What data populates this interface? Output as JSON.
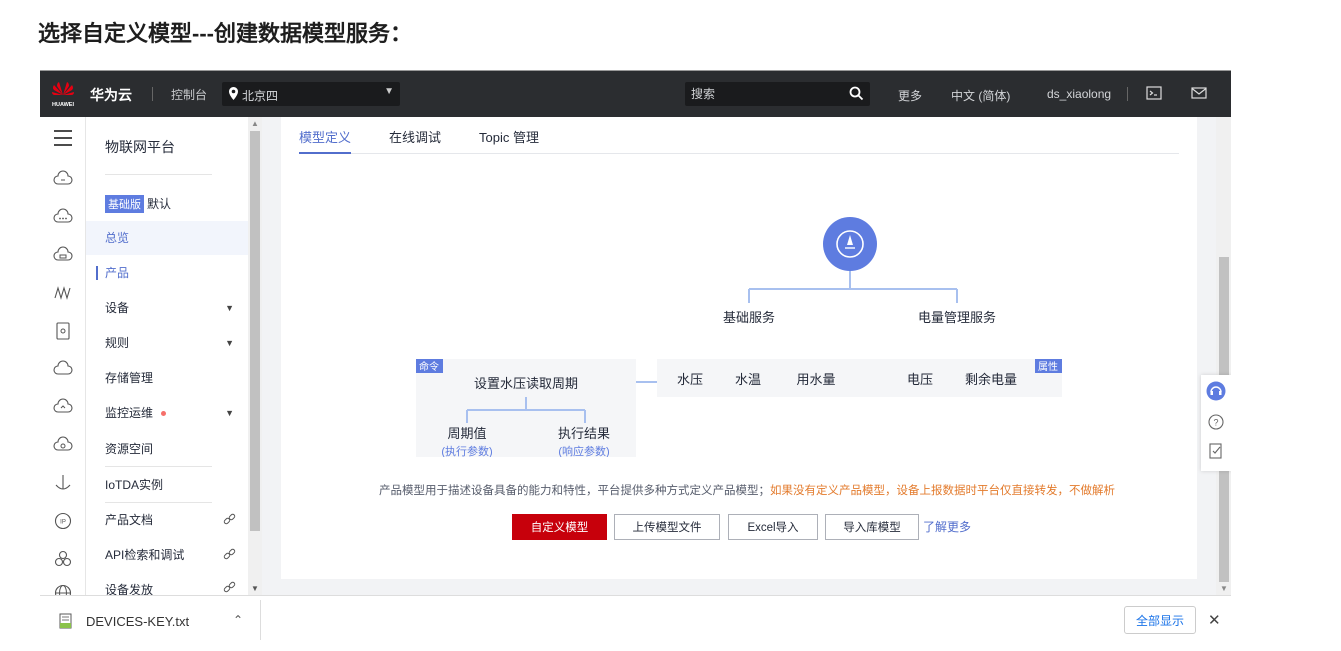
{
  "doc": {
    "heading": "选择自定义模型---创建数据模型服务："
  },
  "topbar": {
    "logo_text": "HUAWEI",
    "brand": "华为云",
    "console": "控制台",
    "region": "北京四",
    "search_placeholder": "搜索",
    "more": "更多",
    "language": "中文 (简体)",
    "user": "ds_xiaolong"
  },
  "nav": {
    "title": "物联网平台",
    "edition_badge": "基础版",
    "edition_value": "默认",
    "items": [
      {
        "label": "总览"
      },
      {
        "label": "产品"
      },
      {
        "label": "设备"
      },
      {
        "label": "规则"
      },
      {
        "label": "存储管理"
      },
      {
        "label": "监控运维"
      },
      {
        "label": "资源空间"
      },
      {
        "label": "IoTDA实例"
      },
      {
        "label": "产品文档"
      },
      {
        "label": "API检索和调试"
      },
      {
        "label": "设备发放"
      }
    ]
  },
  "tabs": [
    {
      "label": "模型定义"
    },
    {
      "label": "在线调试"
    },
    {
      "label": "Topic 管理"
    }
  ],
  "diagram": {
    "services": [
      "基础服务",
      "电量管理服务"
    ],
    "command_tag": "命令",
    "property_tag": "属性",
    "command_name": "设置水压读取周期",
    "command_param": "周期值",
    "command_param_sub": "(执行参数)",
    "command_result": "执行结果",
    "command_result_sub": "(响应参数)",
    "properties": [
      "水压",
      "水温",
      "用水量",
      "电压",
      "剩余电量"
    ]
  },
  "description": {
    "text": "产品模型用于描述设备具备的能力和特性，平台提供多种方式定义产品模型；",
    "warning": "如果没有定义产品模型，设备上报数据时平台仅直接转发，不做解析"
  },
  "buttons": {
    "custom": "自定义模型",
    "upload": "上传模型文件",
    "excel": "Excel导入",
    "library": "导入库模型",
    "learn_more": "了解更多"
  },
  "download": {
    "filename": "DEVICES-KEY.txt",
    "show_all": "全部显示",
    "close": "✕"
  },
  "colors": {
    "brand_red": "#c7000b",
    "accent_blue": "#526ecc",
    "topbar_bg": "#2b2d30",
    "diagram_line": "#a8c0ef",
    "diagram_node": "#5e7ce0"
  }
}
